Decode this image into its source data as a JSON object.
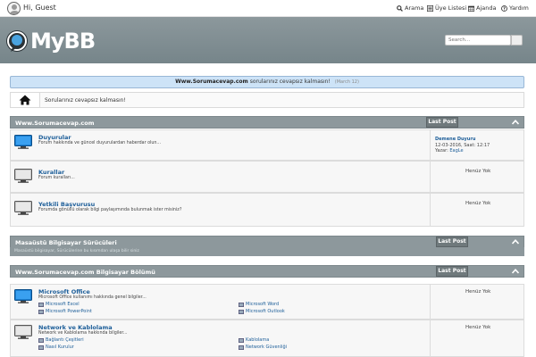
{
  "topbar": {
    "greeting": "Hi, Guest",
    "links": [
      {
        "label": "Arama",
        "icon": "search-icon"
      },
      {
        "label": "Üye Listesi",
        "icon": "member-list-icon"
      },
      {
        "label": "Ajanda",
        "icon": "calendar-icon"
      },
      {
        "label": "Yardım",
        "icon": "help-icon"
      }
    ]
  },
  "header": {
    "logo_text": "MyBB",
    "search_placeholder": "Search..."
  },
  "announcement": {
    "site": "Www.Sorumacevap.com",
    "text": "sorularınız cevapsız kalmasın!",
    "date": "(March 12)"
  },
  "breadcrumb": {
    "text": "Sorularınız cevapsız kalmasın!"
  },
  "categories": [
    {
      "title": "Www.Sorumacevap.com",
      "lastpost_label": "Last Post",
      "forums": [
        {
          "name": "Duyurular",
          "desc": "Forum hakkında ve güncel duyurulardan haberdar olun...",
          "lastpost": {
            "title": "Demene Duyuru",
            "date": "12-03-2016, Saat: 12:17",
            "by_label": "Yazar:",
            "author": "EagLe"
          }
        },
        {
          "name": "Kurallar",
          "desc": "Forum kuralları...",
          "status": "Henüz Yok"
        },
        {
          "name": "Yetkili Başvurusu",
          "desc": "Forumda gönüllü olarak bilgi paylaşımında bulunmak ister misiniz?",
          "status": "Henüz Yok"
        }
      ]
    },
    {
      "title": "Masaüstü Bilgisayar Sürücüleri",
      "lastpost_label": "Last Post",
      "description": "Masaüstü bilgisayar, Sürücülerine bu kısımdan ulaşa bilir siniz"
    },
    {
      "title": "Www.Sorumacevap.com Bilgisayar Bölümü",
      "lastpost_label": "Last Post",
      "forums": [
        {
          "name": "Microsoft Office",
          "desc": "Microsoft Office kullanımı hakkında genel bilgiler...",
          "status": "Henüz Yok",
          "subforums": [
            "Microsoft Excel",
            "Microsoft Word",
            "Microsoft PowerPoint",
            "Microsoft Outlook"
          ]
        },
        {
          "name": "Network ve Kablolama",
          "desc": "Network ve Kablolama hakkında bilgiler...",
          "status": "Henüz Yok",
          "subforums": [
            "Bağlantı Çeşitleri",
            "Kablolama",
            "Nasıl Kurulur",
            "Network Güvenliği"
          ]
        }
      ]
    }
  ],
  "colors": {
    "header": "#7f8c90",
    "link": "#1d5e99",
    "announce_bg": "#cde3f7",
    "category_bar": "#8d989c"
  }
}
